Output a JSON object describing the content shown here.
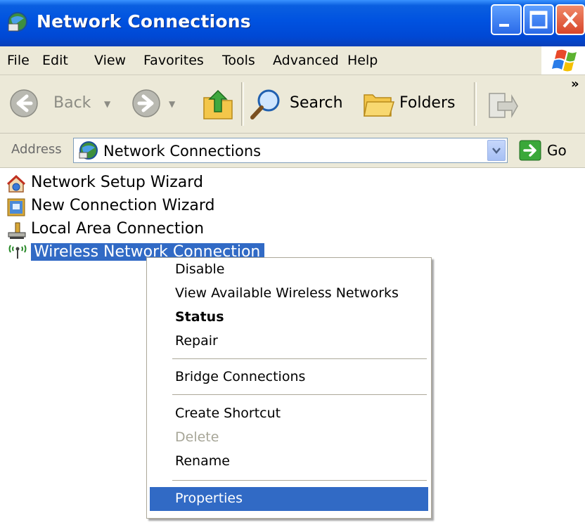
{
  "window": {
    "title": "Network Connections"
  },
  "menubar": {
    "items": [
      "File",
      "Edit",
      "View",
      "Favorites",
      "Tools",
      "Advanced",
      "Help"
    ]
  },
  "toolbar": {
    "back": "Back",
    "search": "Search",
    "folders": "Folders",
    "overflow": "»"
  },
  "address": {
    "label": "Address",
    "value": "Network Connections",
    "go": "Go"
  },
  "items": [
    {
      "label": "Network Setup Wizard",
      "icon": "network-setup-wizard-icon"
    },
    {
      "label": "New Connection Wizard",
      "icon": "new-connection-wizard-icon"
    },
    {
      "label": "Local Area Connection",
      "icon": "lan-connection-icon"
    },
    {
      "label": "Wireless Network Connection",
      "icon": "wireless-connection-icon",
      "selected": true
    }
  ],
  "context_menu": {
    "items": [
      {
        "label": "Disable"
      },
      {
        "label": "View Available Wireless Networks"
      },
      {
        "label": "Status",
        "bold": true
      },
      {
        "label": "Repair"
      },
      {
        "label": "Bridge Connections"
      },
      {
        "label": "Create Shortcut"
      },
      {
        "label": "Delete",
        "disabled": true
      },
      {
        "label": "Rename"
      },
      {
        "label": "Properties",
        "highlighted": true
      }
    ]
  },
  "colors": {
    "titlebar": "#0052e0",
    "selection": "#316ac5",
    "chrome": "#ece9d8",
    "close": "#d8462a"
  }
}
